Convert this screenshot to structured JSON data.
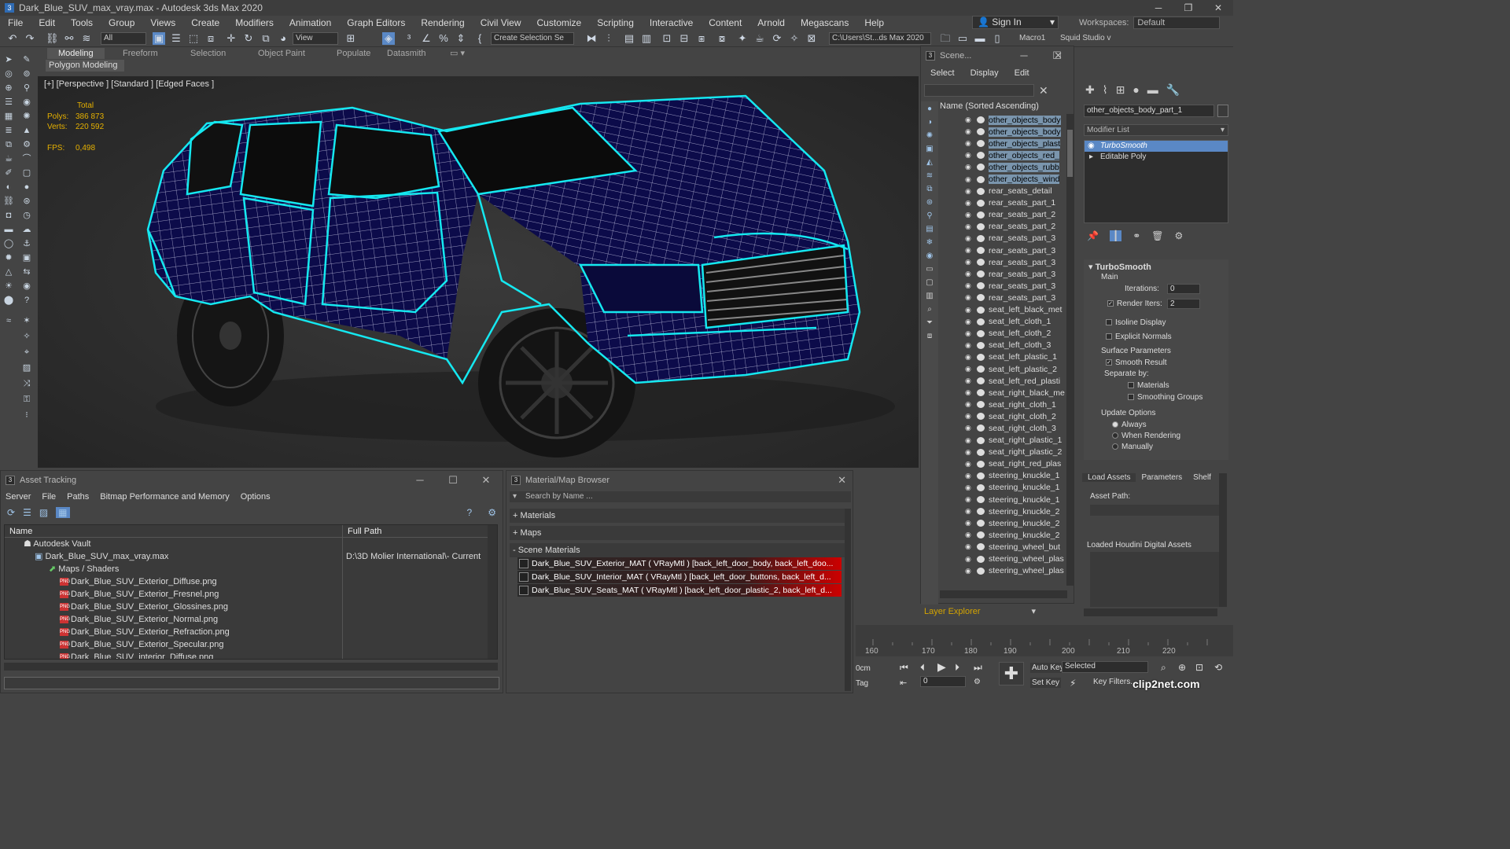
{
  "window": {
    "title": "Dark_Blue_SUV_max_vray.max - Autodesk 3ds Max 2020"
  },
  "menu": [
    "File",
    "Edit",
    "Tools",
    "Group",
    "Views",
    "Create",
    "Modifiers",
    "Animation",
    "Graph Editors",
    "Rendering",
    "Civil View",
    "Customize",
    "Scripting",
    "Interactive",
    "Content",
    "Arnold",
    "Megascans",
    "Help"
  ],
  "account": {
    "signin": "Sign In",
    "workspaces_label": "Workspaces:",
    "workspace": "Default"
  },
  "toolbar": {
    "selection_filter": "All",
    "ref_coord": "View",
    "named_selection": "Create Selection Se",
    "path": "C:\\Users\\St...ds Max 2020",
    "macro": "Macro1",
    "squid": "Squid Studio v"
  },
  "ribbon": {
    "tabs": [
      "Modeling",
      "Freeform",
      "Selection",
      "Object Paint",
      "Populate",
      "Datasmith"
    ],
    "sub": "Polygon Modeling"
  },
  "viewport": {
    "label": "[+] [Perspective ] [Standard ] [Edged Faces ]",
    "total": "Total",
    "polys_label": "Polys:",
    "polys": "386 873",
    "verts_label": "Verts:",
    "verts": "220 592",
    "fps_label": "FPS:",
    "fps": "0,498"
  },
  "scene": {
    "title": "Scene...",
    "menu": [
      "Select",
      "Display",
      "Edit"
    ],
    "header": "Name (Sorted Ascending)",
    "items": [
      "other_objects_body",
      "other_objects_body",
      "other_objects_plast",
      "other_objects_red_",
      "other_objects_rubb",
      "other_objects_wind",
      "rear_seats_detail",
      "rear_seats_part_1",
      "rear_seats_part_2",
      "rear_seats_part_2",
      "rear_seats_part_3",
      "rear_seats_part_3",
      "rear_seats_part_3",
      "rear_seats_part_3",
      "rear_seats_part_3",
      "rear_seats_part_3",
      "seat_left_black_met",
      "seat_left_cloth_1",
      "seat_left_cloth_2",
      "seat_left_cloth_3",
      "seat_left_plastic_1",
      "seat_left_plastic_2",
      "seat_left_red_plasti",
      "seat_right_black_me",
      "seat_right_cloth_1",
      "seat_right_cloth_2",
      "seat_right_cloth_3",
      "seat_right_plastic_1",
      "seat_right_plastic_2",
      "seat_right_red_plas",
      "steering_knuckle_1",
      "steering_knuckle_1",
      "steering_knuckle_1",
      "steering_knuckle_2",
      "steering_knuckle_2",
      "steering_knuckle_2",
      "steering_wheel_but",
      "steering_wheel_plas",
      "steering_wheel_plas"
    ],
    "layer_explorer": "Layer Explorer"
  },
  "command": {
    "object_name": "other_objects_body_part_1",
    "modifier_list": "Modifier List",
    "stack": [
      "TurboSmooth",
      "Editable Poly"
    ],
    "turbosmooth": {
      "title": "TurboSmooth",
      "main": "Main",
      "iterations_label": "Iterations:",
      "iterations": "0",
      "render_iters_label": "Render Iters:",
      "render_iters": "2",
      "isoline": "Isoline Display",
      "explicit": "Explicit Normals",
      "surface": "Surface Parameters",
      "smooth_result": "Smooth Result",
      "separate": "Separate by:",
      "materials": "Materials",
      "smoothing": "Smoothing Groups",
      "update": "Update Options",
      "always": "Always",
      "when_rendering": "When Rendering",
      "manually": "Manually"
    }
  },
  "houdini": {
    "tabs": [
      "Load Assets",
      "Parameters",
      "Shelf"
    ],
    "asset_path": "Asset Path:",
    "loaded": "Loaded Houdini Digital Assets"
  },
  "asset_tracking": {
    "title": "Asset Tracking",
    "menu": [
      "Server",
      "File",
      "Paths",
      "Bitmap Performance and Memory",
      "Options"
    ],
    "columns": [
      "Name",
      "Full Path"
    ],
    "rows": [
      {
        "name": "Autodesk Vault",
        "path": ""
      },
      {
        "name": "Dark_Blue_SUV_max_vray.max",
        "path": "D:\\3D Molier International\\- Current"
      },
      {
        "name": "Maps / Shaders",
        "path": ""
      },
      {
        "name": "Dark_Blue_SUV_Exterior_Diffuse.png",
        "path": ""
      },
      {
        "name": "Dark_Blue_SUV_Exterior_Fresnel.png",
        "path": ""
      },
      {
        "name": "Dark_Blue_SUV_Exterior_Glossines.png",
        "path": ""
      },
      {
        "name": "Dark_Blue_SUV_Exterior_Normal.png",
        "path": ""
      },
      {
        "name": "Dark_Blue_SUV_Exterior_Refraction.png",
        "path": ""
      },
      {
        "name": "Dark_Blue_SUV_Exterior_Specular.png",
        "path": ""
      },
      {
        "name": "Dark_Blue_SUV_interior_Diffuse.png",
        "path": ""
      }
    ]
  },
  "material_browser": {
    "title": "Material/Map Browser",
    "search": "Search by Name ...",
    "groups": [
      "+ Materials",
      "+ Maps",
      "- Scene Materials"
    ],
    "materials": [
      "Dark_Blue_SUV_Exterior_MAT ( VRayMtl ) [back_left_door_body, back_left_doo...",
      "Dark_Blue_SUV_Interior_MAT ( VRayMtl ) [back_left_door_buttons, back_left_d...",
      "Dark_Blue_SUV_Seats_MAT ( VRayMtl ) [back_left_door_plastic_2, back_left_d..."
    ]
  },
  "timeline": {
    "ticks": [
      "160",
      "170",
      "180",
      "190",
      "200",
      "210",
      "220"
    ]
  },
  "animation": {
    "frame_field": "0cm",
    "tag": "Tag",
    "frame": "0",
    "auto_key": "Auto Key",
    "set_key": "Set Key",
    "selected": "Selected",
    "key_filters": "Key Filters..."
  },
  "watermark": "clip2net.com",
  "colors": {
    "wire_cyan": "#15e8f0",
    "body_navy": "#0c0b4a",
    "stats_yellow": "#e5b000"
  }
}
